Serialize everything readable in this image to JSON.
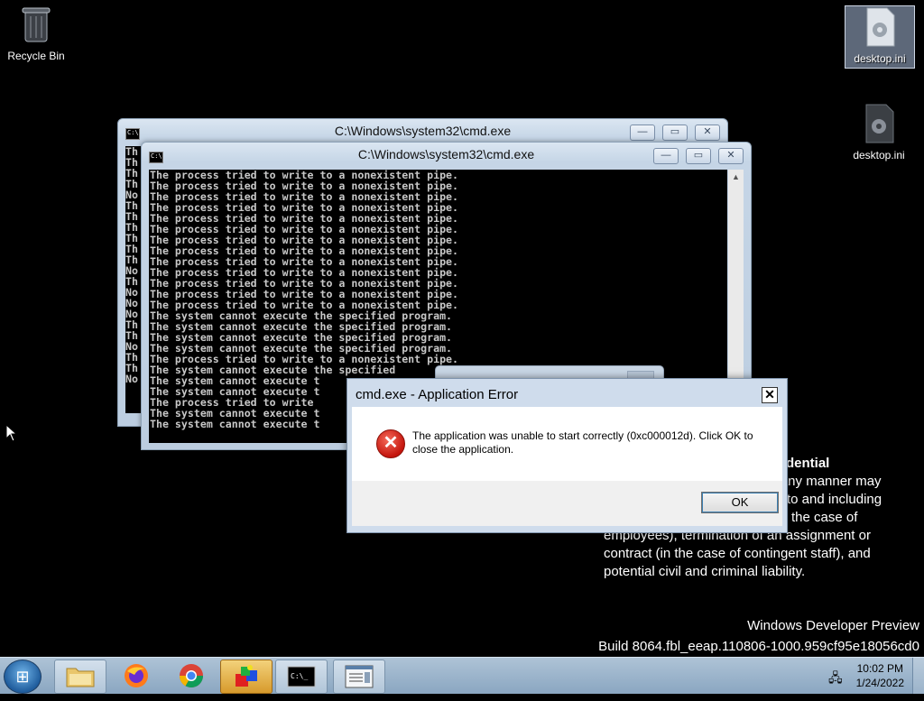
{
  "desktop": {
    "icons": [
      {
        "label": "Recycle Bin"
      },
      {
        "label": "desktop.ini"
      },
      {
        "label": "desktop.ini"
      }
    ]
  },
  "notice": {
    "heading": "dential",
    "lines": [
      "in any manner may",
      "to and including",
      "the case of",
      "employees), termination of an assignment or",
      "contract (in the case of contingent staff), and",
      "potential civil and criminal liability."
    ]
  },
  "watermark": {
    "line1": "Windows Developer Preview",
    "line2": "Build 8064.fbl_eeap.110806-1000.959cf95e18056cd0"
  },
  "cmd_back": {
    "title": "C:\\Windows\\system32\\cmd.exe",
    "console": "Th\nTh\nTh\nTh\nNo\nTh\nTh\nTh\nTh\nTh\nTh\nNo\nTh\nNo\nNo\nNo\nTh\nTh\nNo\nTh\nTh\nNo"
  },
  "cmd_front": {
    "title": "C:\\Windows\\system32\\cmd.exe",
    "console": "The process tried to write to a nonexistent pipe.\nThe process tried to write to a nonexistent pipe.\nThe process tried to write to a nonexistent pipe.\nThe process tried to write to a nonexistent pipe.\nThe process tried to write to a nonexistent pipe.\nThe process tried to write to a nonexistent pipe.\nThe process tried to write to a nonexistent pipe.\nThe process tried to write to a nonexistent pipe.\nThe process tried to write to a nonexistent pipe.\nThe process tried to write to a nonexistent pipe.\nThe process tried to write to a nonexistent pipe.\nThe process tried to write to a nonexistent pipe.\nThe process tried to write to a nonexistent pipe.\nThe system cannot execute the specified program.\nThe system cannot execute the specified program.\nThe system cannot execute the specified program.\nThe system cannot execute the specified program.\nThe process tried to write to a nonexistent pipe.\nThe system cannot execute the specified\nThe system cannot execute t\nThe system cannot execute t\nThe process tried to write\nThe system cannot execute t\nThe system cannot execute t"
  },
  "error_dialog": {
    "title": "cmd.exe - Application Error",
    "message": "The application was unable to start correctly (0xc000012d). Click OK to close the application.",
    "ok_label": "OK",
    "close_glyph": "✕"
  },
  "taskbar": {
    "clock_time": "10:02 PM",
    "clock_date": "1/24/2022",
    "apps": [
      "file-explorer",
      "firefox",
      "chrome",
      "paint-app",
      "command-prompt",
      "notepad-window"
    ]
  },
  "window_controls": {
    "minimize": "—",
    "maximize": "▭",
    "close": "✕"
  }
}
